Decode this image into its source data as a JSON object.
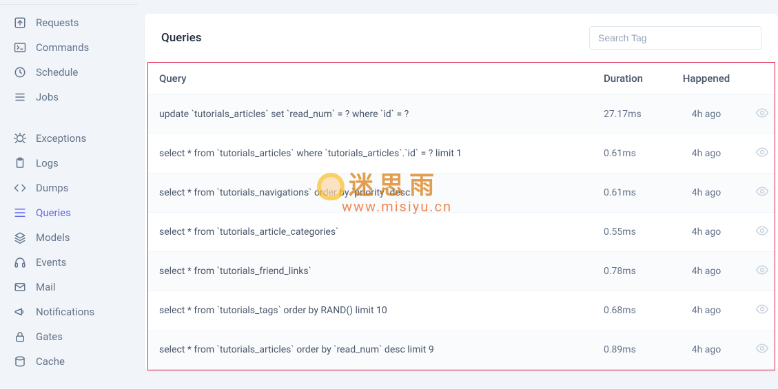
{
  "sidebar": {
    "items": [
      {
        "label": "Requests",
        "icon": "arrow-up-square"
      },
      {
        "label": "Commands",
        "icon": "terminal"
      },
      {
        "label": "Schedule",
        "icon": "clock"
      },
      {
        "label": "Jobs",
        "icon": "list"
      },
      {
        "label": "Exceptions",
        "icon": "bug"
      },
      {
        "label": "Logs",
        "icon": "clipboard"
      },
      {
        "label": "Dumps",
        "icon": "code"
      },
      {
        "label": "Queries",
        "icon": "menu-lines",
        "active": true
      },
      {
        "label": "Models",
        "icon": "layers"
      },
      {
        "label": "Events",
        "icon": "headphones"
      },
      {
        "label": "Mail",
        "icon": "mail"
      },
      {
        "label": "Notifications",
        "icon": "megaphone"
      },
      {
        "label": "Gates",
        "icon": "lock"
      },
      {
        "label": "Cache",
        "icon": "database"
      }
    ]
  },
  "header": {
    "title": "Queries",
    "search_placeholder": "Search Tag"
  },
  "table": {
    "columns": {
      "query": "Query",
      "duration": "Duration",
      "happened": "Happened"
    },
    "rows": [
      {
        "query": "update `tutorials_articles` set `read_num` = ? where `id` = ?",
        "duration": "27.17ms",
        "happened": "4h ago"
      },
      {
        "query": "select * from `tutorials_articles` where `tutorials_articles`.`id` = ? limit 1",
        "duration": "0.61ms",
        "happened": "4h ago"
      },
      {
        "query": "select * from `tutorials_navigations` order by `priority` desc",
        "duration": "0.61ms",
        "happened": "4h ago"
      },
      {
        "query": "select * from `tutorials_article_categories`",
        "duration": "0.55ms",
        "happened": "4h ago"
      },
      {
        "query": "select * from `tutorials_friend_links`",
        "duration": "0.78ms",
        "happened": "4h ago"
      },
      {
        "query": "select * from `tutorials_tags` order by RAND() limit 10",
        "duration": "0.68ms",
        "happened": "4h ago"
      },
      {
        "query": "select * from `tutorials_articles` order by `read_num` desc limit 9",
        "duration": "0.89ms",
        "happened": "4h ago"
      }
    ]
  },
  "watermark": {
    "text": "迷思雨",
    "url": "www.misiyu.cn"
  }
}
